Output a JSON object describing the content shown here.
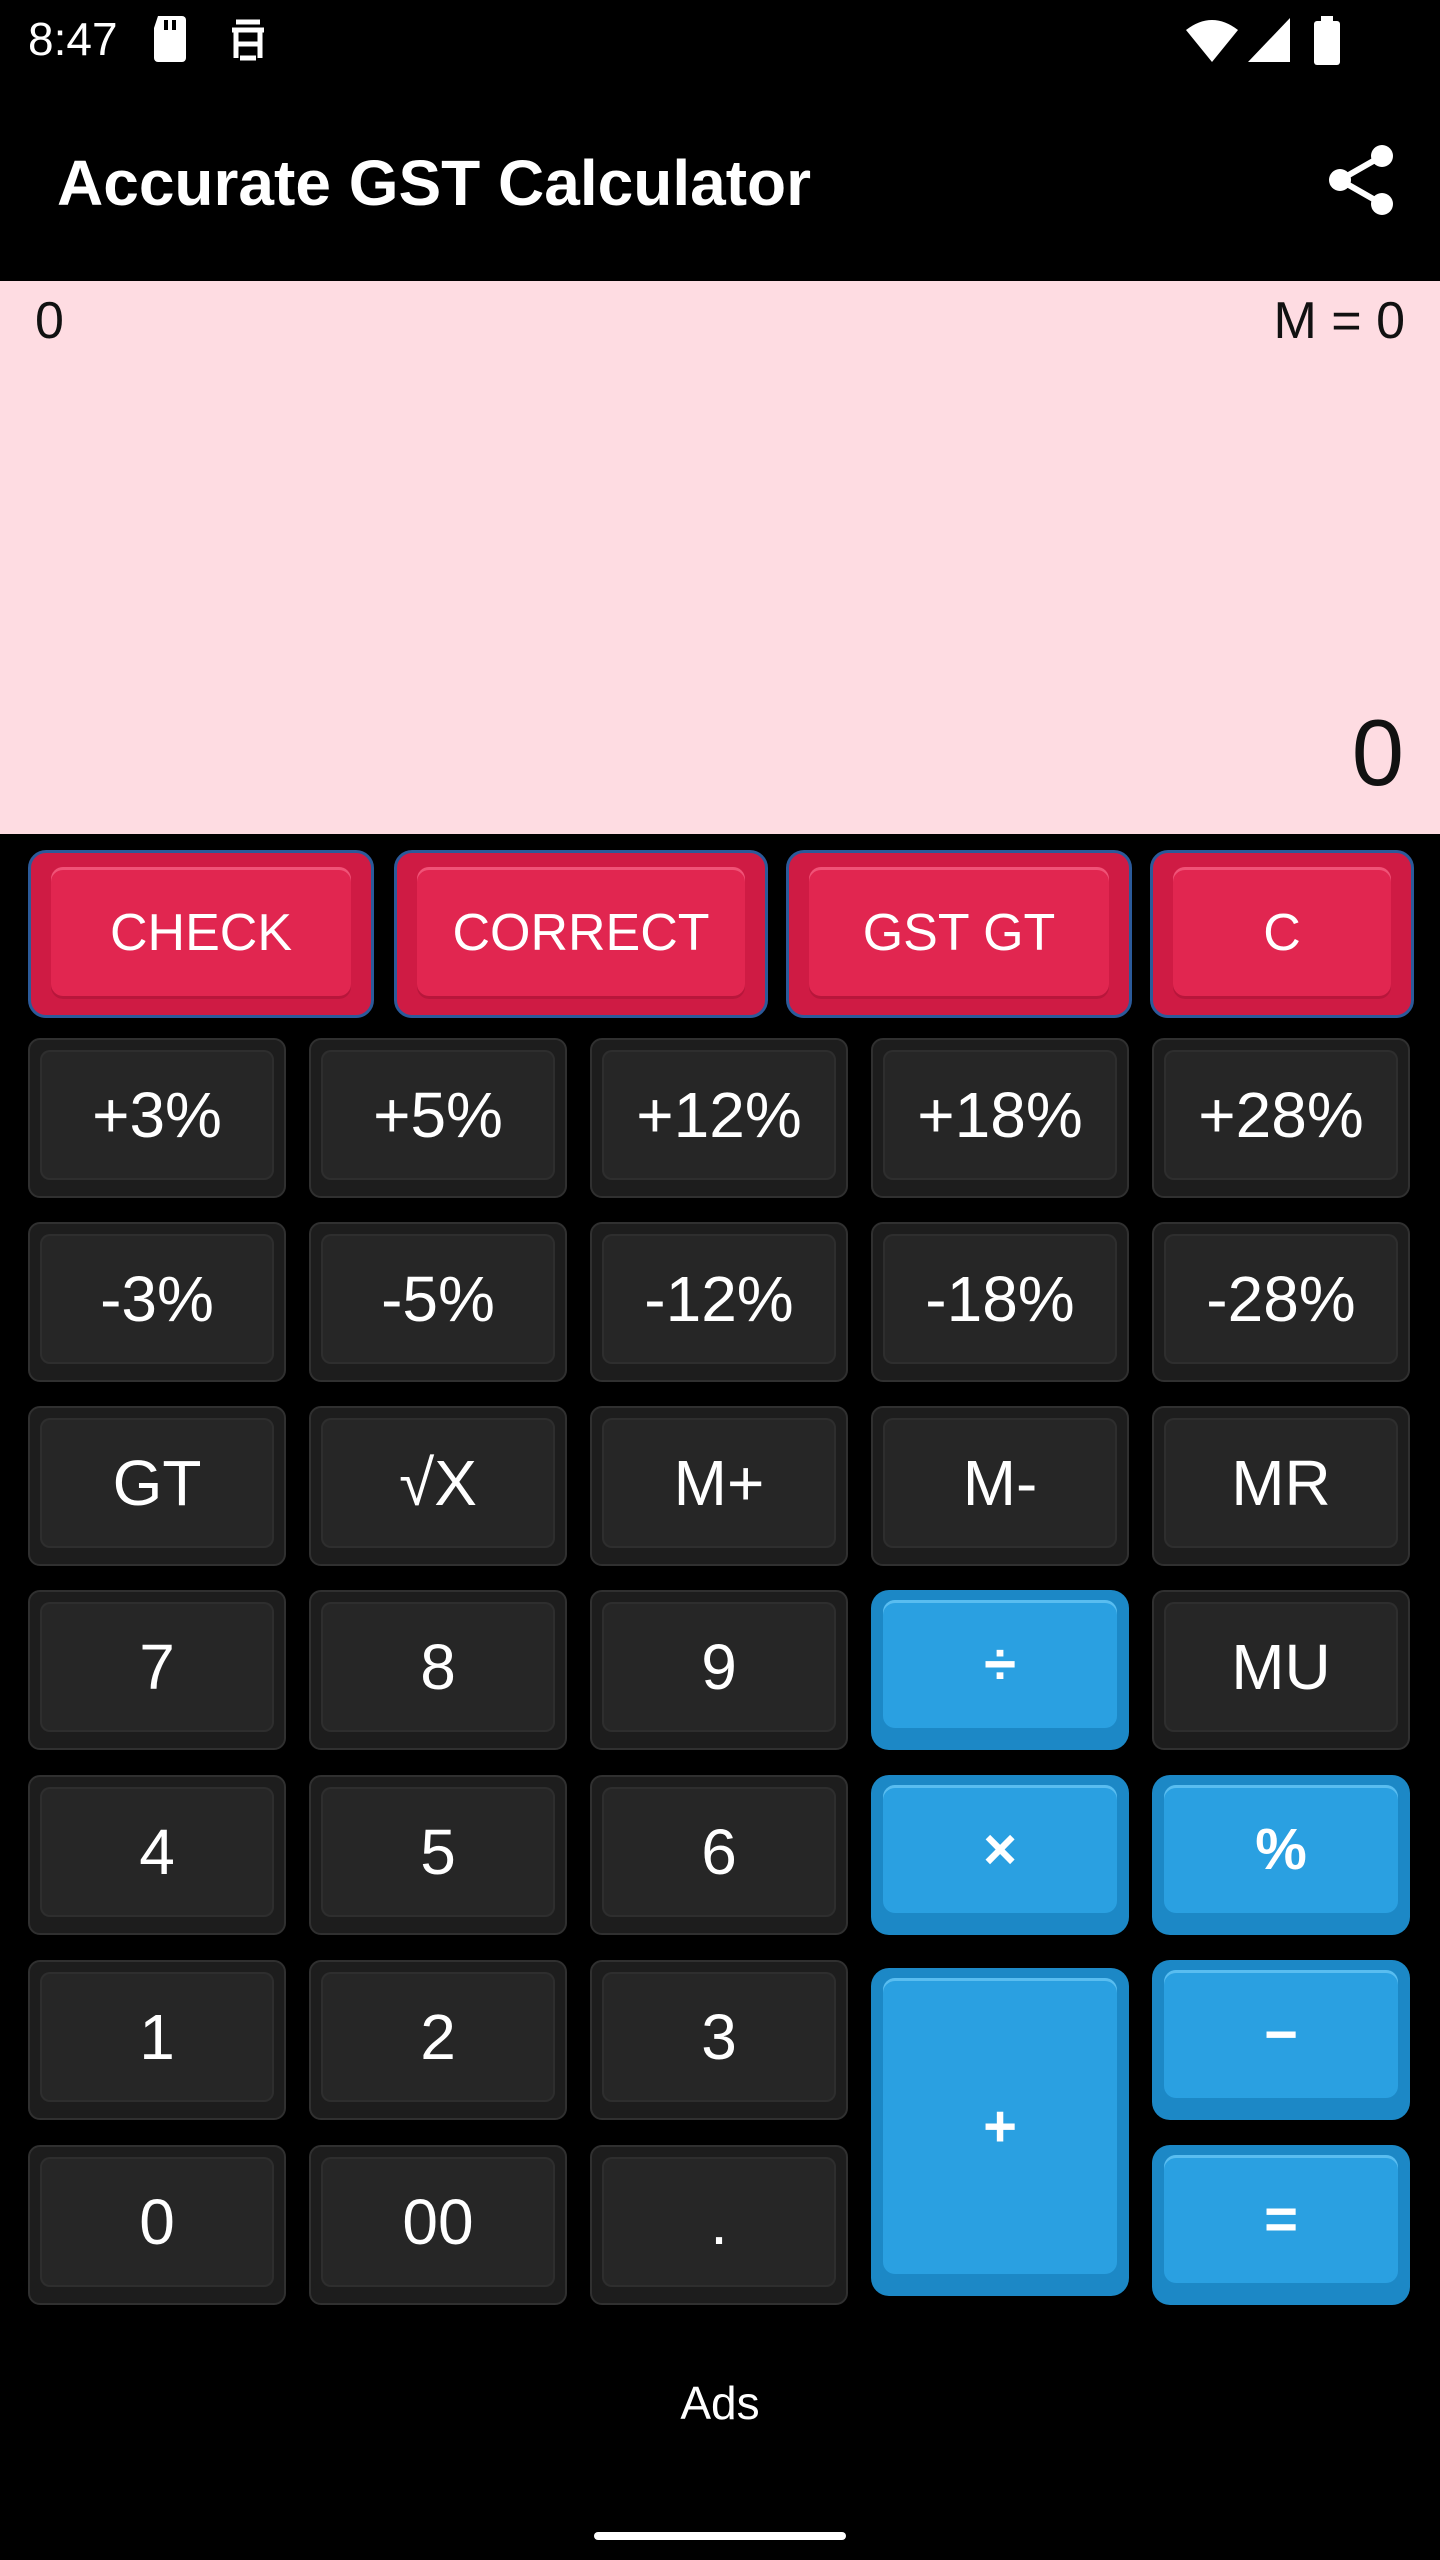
{
  "status_bar": {
    "time": "8:47"
  },
  "app_bar": {
    "title": "Accurate GST Calculator"
  },
  "display": {
    "expression": "0",
    "memory": "M = 0",
    "result": "0"
  },
  "function_row": [
    "CHECK",
    "CORRECT",
    "GST GT",
    "C"
  ],
  "keys": {
    "plus3": "+3%",
    "plus5": "+5%",
    "plus12": "+12%",
    "plus18": "+18%",
    "plus28": "+28%",
    "minus3": "-3%",
    "minus5": "-5%",
    "minus12": "-12%",
    "minus18": "-18%",
    "minus28": "-28%",
    "gt": "GT",
    "sqrt": "√X",
    "mplus": "M+",
    "mminus": "M-",
    "mr": "MR",
    "seven": "7",
    "eight": "8",
    "nine": "9",
    "divide": "÷",
    "mu": "MU",
    "four": "4",
    "five": "5",
    "six": "6",
    "multiply": "×",
    "percent": "%",
    "one": "1",
    "two": "2",
    "three": "3",
    "add": "+",
    "subtract": "−",
    "zero": "0",
    "double_zero": "00",
    "decimal": ".",
    "equals": "="
  },
  "ads": {
    "label": "Ads"
  },
  "colors": {
    "display_bg": "#fedce2",
    "function_key": "#e12650",
    "operator_key": "#2aa0e1",
    "number_key": "#262626"
  }
}
